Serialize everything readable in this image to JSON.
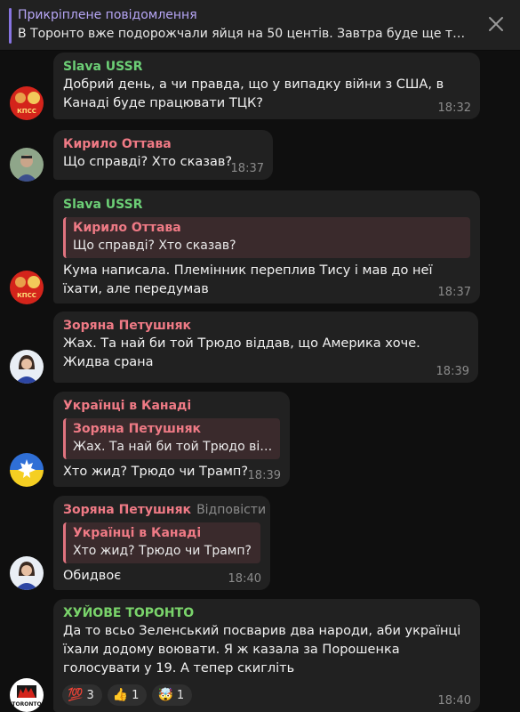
{
  "pinned": {
    "title": "Прикріплене повідомлення",
    "text": "В Торонто вже подорожчали яйця на 50 центів. Завтра буде ще так..."
  },
  "colors": {
    "slava": "#6ccf76",
    "kyrylo": "#ef7a85",
    "zoriana": "#ef7a85",
    "ukraintsi": "#ef7a85",
    "toronto": "#7ad46b",
    "bubble": "#212121",
    "background": "#0f0f0f"
  },
  "messages": [
    {
      "sender": "Slava USSR",
      "text": "Добрий день, а чи правда, що у випадку війни з США, в Канаді буде працювати ТЦК?",
      "time": "18:32"
    },
    {
      "sender": "Кирило Оттава",
      "text": "Що справді? Хто сказав?",
      "time": "18:37"
    },
    {
      "sender": "Slava USSR",
      "reply": {
        "name": "Кирило Оттава",
        "text": "Що справді? Хто сказав?"
      },
      "text": "Кума написала. Племінник переплив Тису і мав до неї їхати, але передумав",
      "time": "18:37"
    },
    {
      "sender": "Зоряна Петушняк",
      "text": "Жах. Та най би той Трюдо віддав, що Америка хоче. Жидва срана",
      "time": "18:39"
    },
    {
      "sender": "Українці в Канаді",
      "reply": {
        "name": "Зоряна Петушняк",
        "text": "Жах. Та най би той Трюдо від..."
      },
      "text": "Хто жид? Трюдо чи Трамп?",
      "time": "18:39"
    },
    {
      "sender": "Зоряна Петушняк",
      "action": "Відповісти",
      "reply": {
        "name": "Українці в Канаді",
        "text": "Хто жид? Трюдо чи Трамп?"
      },
      "text": "Обидвоє",
      "time": "18:40"
    },
    {
      "sender": "ХУЙОВЕ ТОРОНТО",
      "text": "Да то всьо Зеленський посварив два народи, аби українці їхали додому воювати. Я ж казала за Порошенка голосувати у 19. А тепер скигліть",
      "time": "18:40",
      "reactions": [
        {
          "emoji": "💯",
          "count": "3"
        },
        {
          "emoji": "👍",
          "count": "1"
        },
        {
          "emoji": "🤯",
          "count": "1"
        }
      ]
    }
  ],
  "avatars": {
    "kpss_label": "КПСС",
    "toronto_label": "TORONTO"
  }
}
